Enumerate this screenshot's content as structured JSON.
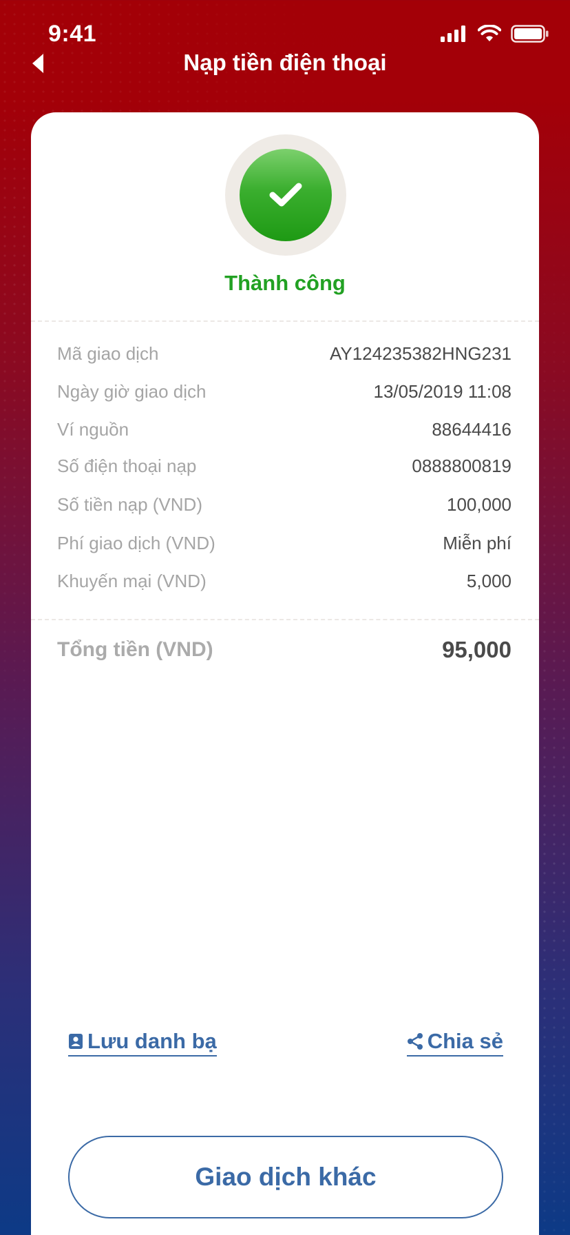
{
  "status_bar": {
    "time": "9:41"
  },
  "header": {
    "title": "Nạp tiền điện thoại"
  },
  "result": {
    "status_text": "Thành công",
    "status_color": "#22a123"
  },
  "details": [
    {
      "label": "Mã giao dịch",
      "value": "AY124235382HNG231"
    },
    {
      "label": "Ngày giờ giao dịch",
      "value": "13/05/2019 11:08"
    },
    {
      "label": "Ví nguồn",
      "value": "88644416"
    },
    {
      "label": "Số điện thoại nạp",
      "value": "0888800819"
    },
    {
      "label": "Số tiền nạp (VND)",
      "value": "100,000"
    },
    {
      "label": "Phí giao dịch (VND)",
      "value": "Miễn phí"
    },
    {
      "label": "Khuyến mại (VND)",
      "value": "5,000"
    }
  ],
  "total": {
    "label": "Tổng tiền (VND)",
    "value": "95,000"
  },
  "actions": {
    "save_contact_label": "Lưu danh bạ",
    "share_label": "Chia sẻ",
    "other_transaction_label": "Giao dịch khác"
  },
  "colors": {
    "accent": "#3b6aa6",
    "header_red": "#a30007"
  }
}
